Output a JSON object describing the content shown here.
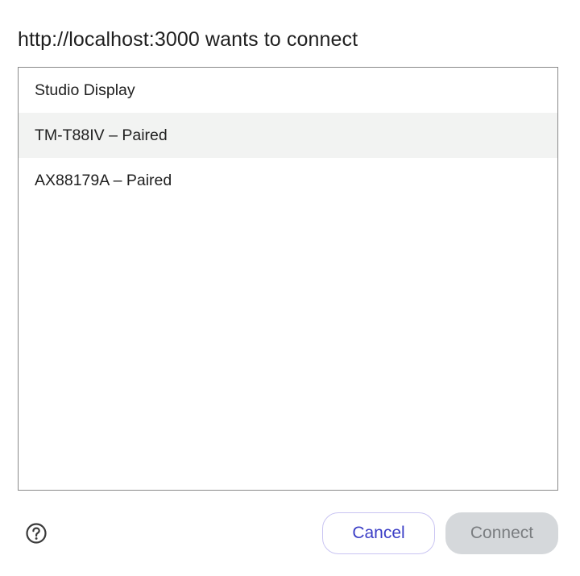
{
  "dialog": {
    "title": "http://localhost:3000 wants to connect"
  },
  "devices": [
    {
      "label": "Studio Display",
      "highlighted": false
    },
    {
      "label": "TM-T88IV – Paired",
      "highlighted": true
    },
    {
      "label": "AX88179A – Paired",
      "highlighted": false
    }
  ],
  "footer": {
    "help_icon": "help-circle-icon",
    "cancel_label": "Cancel",
    "connect_label": "Connect",
    "connect_enabled": false
  },
  "colors": {
    "accent": "#3b3ec6",
    "highlight_row": "#f2f3f2",
    "disabled_button_bg": "#d5d8db",
    "disabled_button_text": "#7a7d80"
  }
}
